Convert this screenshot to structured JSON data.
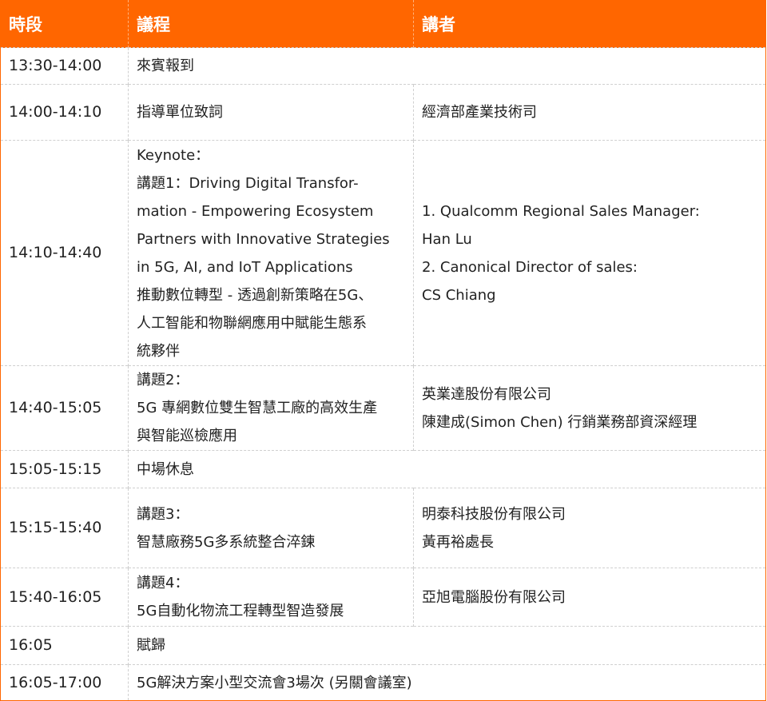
{
  "header": {
    "time": "時段",
    "agenda": "議程",
    "speaker": "講者"
  },
  "rows": [
    {
      "time": "13:30-14:00",
      "agenda": [
        "來賓報到"
      ]
    },
    {
      "time": "14:00-14:10",
      "agenda": [
        "指導單位致詞"
      ],
      "speaker": [
        "經濟部產業技術司"
      ]
    },
    {
      "time": "14:10-14:40",
      "agenda": [
        "Keynote：",
        "講題1：Driving Digital Transfor-",
        "mation - Empowering Ecosystem",
        "Partners with Innovative Strategies",
        "in 5G, AI, and IoT Applications",
        "推動數位轉型 - 透過創新策略在5G、",
        "人工智能和物聯網應用中賦能生態系",
        "統夥伴"
      ],
      "speaker": [
        "1. Qualcomm Regional Sales Manager:",
        "Han Lu",
        "2. Canonical Director of sales:",
        "CS Chiang"
      ]
    },
    {
      "time": "14:40-15:05",
      "agenda": [
        "講題2：",
        "5G 專網數位雙生智慧工廠的高效生產",
        "與智能巡檢應用"
      ],
      "speaker": [
        "英業達股份有限公司",
        "陳建成(Simon Chen) 行銷業務部資深經理"
      ]
    },
    {
      "time": "15:05-15:15",
      "agenda": [
        "中場休息"
      ]
    },
    {
      "time": "15:15-15:40",
      "agenda": [
        "講題3：",
        "智慧廠務5G多系統整合淬鍊"
      ],
      "speaker": [
        "明泰科技股份有限公司",
        "黃再裕處長"
      ]
    },
    {
      "time": "15:40-16:05",
      "agenda": [
        "講題4：",
        "5G自動化物流工程轉型智造發展"
      ],
      "speaker": [
        "亞旭電腦股份有限公司"
      ]
    },
    {
      "time": "16:05",
      "agenda": [
        "賦歸"
      ]
    },
    {
      "time": "16:05-17:00",
      "agenda": [
        "5G解決方案小型交流會3場次 (另關會議室)"
      ]
    }
  ]
}
